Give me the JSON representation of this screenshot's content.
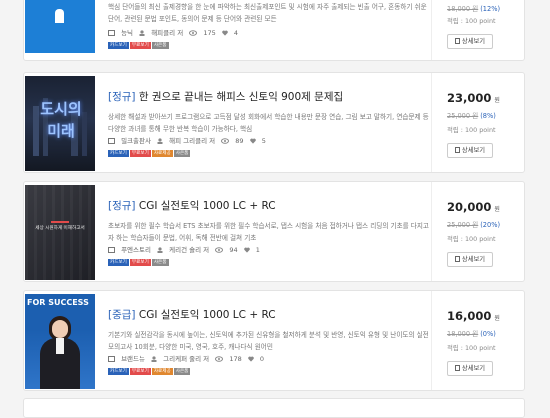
{
  "cards": [
    {
      "title_tag": "",
      "title": "",
      "desc": "핵심 단어들의 최신 출제경향을 한 눈에 파악하는 최신출제포인트 및 시험에 자주 출제되는 빈출 어구, 혼동하기 쉬운 단어, 관련된 문법 포인트, 동의어 문제 등 단어와 관련된 모든",
      "publisher": "능닉",
      "author": "해피클리 저",
      "views": "175",
      "likes": "4",
      "badges": [
        {
          "label": "카드보기",
          "color": "#2a62b8"
        },
        {
          "label": "무료보기",
          "color": "#e24b4b"
        },
        {
          "label": "사은품",
          "color": "#8a8a8a"
        }
      ],
      "price": "",
      "won": "",
      "original": "18,000 원",
      "discount": "(12%)",
      "point": "적립 : 100 point",
      "detail_label": "상세보기",
      "cover": {
        "bg": "#1d7fd6",
        "text": "",
        "accent": "#ffffff"
      }
    },
    {
      "title_tag": "[정규]",
      "title": "한 권으로 끝내는 해피스 신토익 900제 문제집",
      "desc": "상세한 해설과 받아쓰기 프로그램으로 고득점 달성 회화에서 학습한 내용만 문장 연습, 그림 보고 말하기, 연습문제 등 다양한 과녀를 통해 무한 반복 학습이 가능하다, 핵심",
      "publisher": "밀크출판사",
      "author": "해피 그리클리 저",
      "views": "89",
      "likes": "5",
      "badges": [
        {
          "label": "카드보기",
          "color": "#2a62b8"
        },
        {
          "label": "무료보기",
          "color": "#e24b4b"
        },
        {
          "label": "자료제공",
          "color": "#e0872f"
        },
        {
          "label": "사은품",
          "color": "#8a8a8a"
        }
      ],
      "price": "23,000",
      "won": "원",
      "original": "25,000 원",
      "discount": "(8%)",
      "point": "적립 : 100 point",
      "detail_label": "상세보기",
      "cover": {
        "bg": "#1a2030",
        "text": "도시의 미래",
        "accent": "#8fb8ff"
      }
    },
    {
      "title_tag": "[정규]",
      "title": "CGI 실전토익 1000 LC + RC",
      "desc": "초보자를 위한 필수 학습서 ETS 초보자를 위한 필수 학습서로, 탭스 시험을 처음 접하거나 탭스 리딩의 기초를 다지고자 하는 학습자들이 문법, 어휘, 독해 전반에 걸쳐 기초",
      "publisher": "푸엔스토리",
      "author": "케리건 숄리 저",
      "views": "94",
      "likes": "1",
      "badges": [
        {
          "label": "카드보기",
          "color": "#2a62b8"
        },
        {
          "label": "무료보기",
          "color": "#e24b4b"
        },
        {
          "label": "사은품",
          "color": "#8a8a8a"
        }
      ],
      "price": "20,000",
      "won": "원",
      "original": "25,000 원",
      "discount": "(20%)",
      "point": "적립 : 100 point",
      "detail_label": "상세보기",
      "cover": {
        "bg": "#2c2d33",
        "text": "세상 시원하게 이해하고서",
        "accent": "#e24b4b"
      }
    },
    {
      "title_tag": "[중급]",
      "title": "CGI 실전토익 1000 LC + RC",
      "desc": "기본기와 실전감각을 동시에 높이는, 신토익에 추가된 신유형을 철저하게 분석 및 반영, 신토익 유형 및 난이도의 실전모의고사 10회분, 다양한 미국, 영국, 호주, 캐나다식 원어민",
      "publisher": "브랜드뉴",
      "author": "그리케퍼 줄리 저",
      "views": "178",
      "likes": "0",
      "badges": [
        {
          "label": "카드보기",
          "color": "#2a62b8"
        },
        {
          "label": "무료보기",
          "color": "#e24b4b"
        },
        {
          "label": "자료제공",
          "color": "#e0872f"
        },
        {
          "label": "사은품",
          "color": "#8a8a8a"
        }
      ],
      "price": "16,000",
      "won": "원",
      "original": "18,000 원",
      "discount": "(0%)",
      "point": "적립 : 100 point",
      "detail_label": "상세보기",
      "cover": {
        "bg": "#ffffff",
        "text": "FOR SUCCESS",
        "accent": "#1c5fb0"
      }
    }
  ]
}
